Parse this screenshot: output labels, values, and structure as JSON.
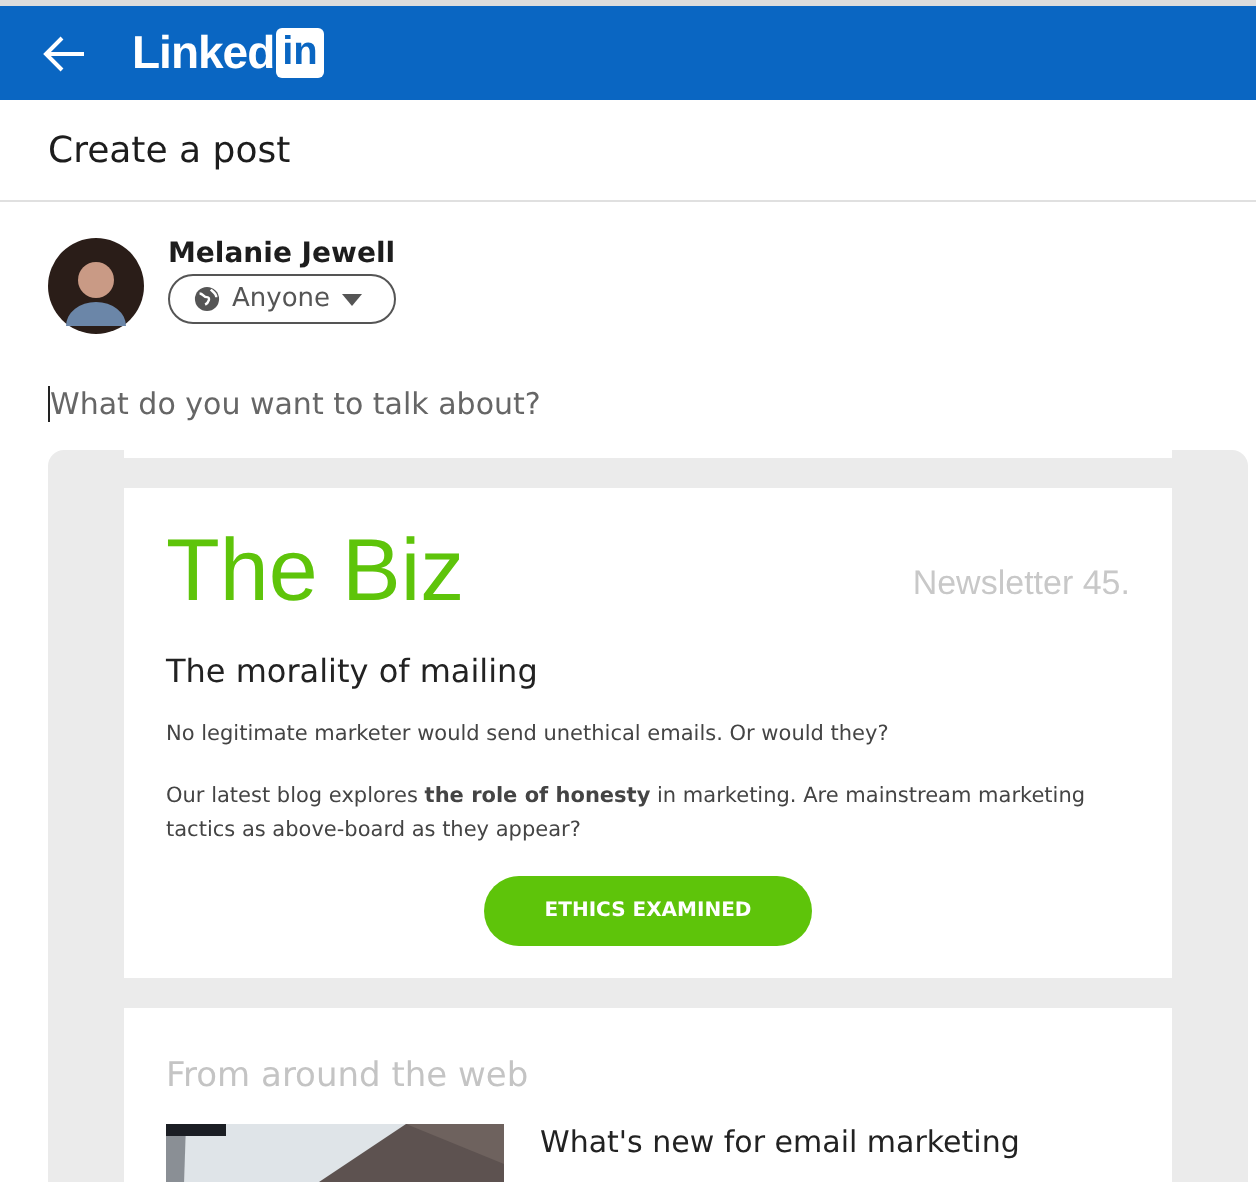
{
  "header": {
    "logo_word": "Linked",
    "logo_badge": "in"
  },
  "page_title": "Create a post",
  "author": {
    "name": "Melanie Jewell",
    "audience": "Anyone"
  },
  "composer": {
    "placeholder": "What do you want to talk about?"
  },
  "preview": {
    "newsletter": {
      "brand": "The Biz",
      "issue": "Newsletter 45.",
      "headline": "The morality of mailing",
      "paragraphs": [
        "No legitimate marketer would send unethical emails. Or would they?",
        "Our latest blog explores **the role of honesty** in marketing. Are mainstream marketing tactics as above-board as they appear?"
      ],
      "button": "ETHICS EXAMINED"
    },
    "web_section": {
      "heading": "From around the web",
      "article_title": "What's new for email marketing"
    }
  }
}
